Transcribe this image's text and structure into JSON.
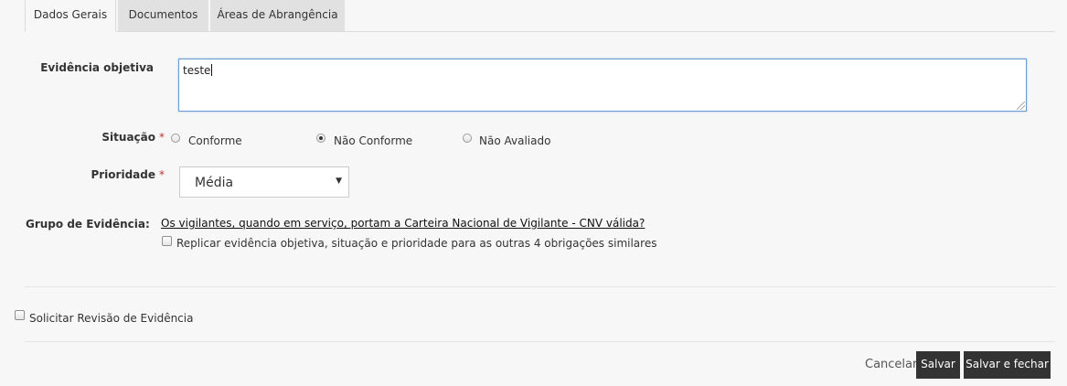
{
  "tabs": [
    {
      "label": "Dados Gerais",
      "active": true
    },
    {
      "label": "Documentos",
      "active": false
    },
    {
      "label": "Áreas de Abrangência",
      "active": false
    }
  ],
  "form": {
    "evidencia_label": "Evidência objetiva",
    "evidencia_value": "teste",
    "situacao_label": "Situação",
    "required_mark": "*",
    "situacao_options": [
      "Conforme",
      "Não Conforme",
      "Não Avaliado"
    ],
    "situacao_selected": "Não Conforme",
    "prioridade_label": "Prioridade",
    "prioridade_value": "Média",
    "grupo_label": "Grupo de Evidência:",
    "grupo_link": "Os vigilantes, quando em serviço, portam a Carteira Nacional de Vigilante - CNV válida?",
    "replicar_label": "Replicar evidência objetiva, situação e prioridade para as outras 4 obrigações similares",
    "replicar_checked": false,
    "revisao_label": "Solicitar Revisão de Evidência",
    "revisao_checked": false
  },
  "footer": {
    "cancel_label": "Cancelar",
    "save_label": "Salvar",
    "save_close_label": "Salvar e fechar"
  },
  "colors": {
    "button_bg": "#333333",
    "required": "#c9302c",
    "focus_border": "#6d9bd1"
  }
}
